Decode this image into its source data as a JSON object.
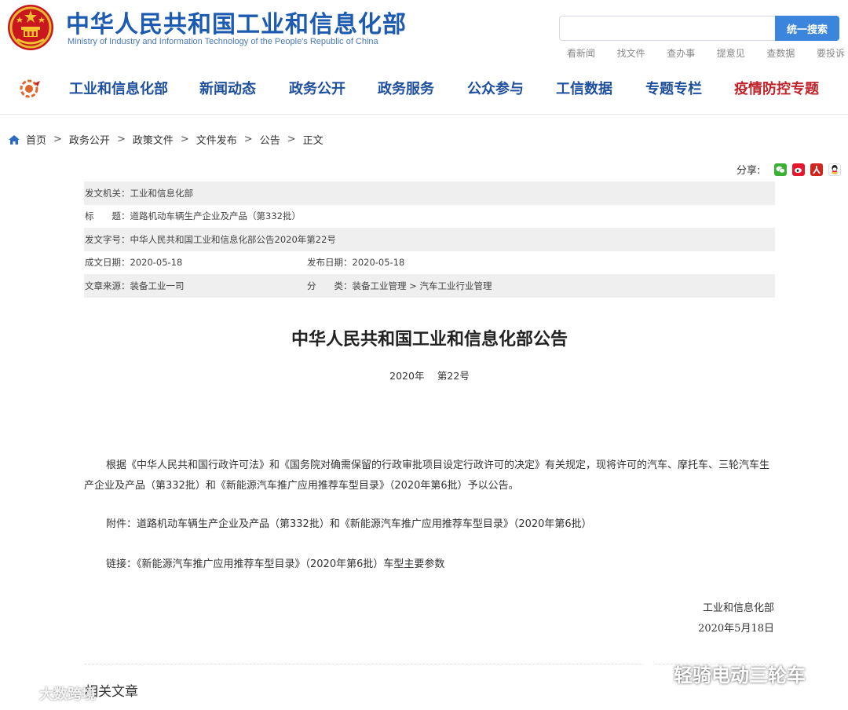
{
  "header": {
    "title_cn": "中华人民共和国工业和信息化部",
    "title_en": "Ministry of Industry and Information Technology of the People's Republic of China",
    "search_button": "统一搜索",
    "quick_links": [
      "看新闻",
      "找文件",
      "查办事",
      "提意见",
      "查数据",
      "要投诉"
    ]
  },
  "nav": {
    "items": [
      {
        "label": "工业和信息化部",
        "color": "#1d4f9c"
      },
      {
        "label": "新闻动态",
        "color": "#1d4f9c"
      },
      {
        "label": "政务公开",
        "color": "#1d4f9c"
      },
      {
        "label": "政务服务",
        "color": "#1d4f9c"
      },
      {
        "label": "公众参与",
        "color": "#1d4f9c"
      },
      {
        "label": "工信数据",
        "color": "#1d4f9c"
      },
      {
        "label": "专题专栏",
        "color": "#1d4f9c"
      },
      {
        "label": "疫情防控专题",
        "color": "#c0242b"
      }
    ]
  },
  "breadcrumb": {
    "items": [
      "首页",
      "政务公开",
      "政策文件",
      "文件发布",
      "公告",
      "正文"
    ],
    "separator": ">"
  },
  "share": {
    "label": "分享:",
    "icons": [
      "wechat-icon",
      "weibo-icon",
      "people-daily-icon",
      "qq-icon"
    ]
  },
  "meta": {
    "issuer_label": "发文机关：",
    "issuer_value": "工业和信息化部",
    "title_label": "标　　题：",
    "title_value": "道路机动车辆生产企业及产品（第332批）",
    "doc_no_label": "发文字号：",
    "doc_no_value": "中华人民共和国工业和信息化部公告2020年第22号",
    "created_label": "成文日期：",
    "created_value": "2020-05-18",
    "published_label": "发布日期：",
    "published_value": "2020-05-18",
    "source_label": "文章来源：",
    "source_value": "装备工业一司",
    "category_label": "分　　类：",
    "category_value": "装备工业管理 > 汽车工业行业管理"
  },
  "article": {
    "title": "中华人民共和国工业和信息化部公告",
    "number": "2020年　 第22号",
    "paragraph1": "根据《中华人民共和国行政许可法》和《国务院对确需保留的行政审批项目设定行政许可的决定》有关规定，现将许可的汽车、摩托车、三轮汽车生产企业及产品（第332批）和《新能源汽车推广应用推荐车型目录》（2020年第6批）予以公告。",
    "attachment": "附件：道路机动车辆生产企业及产品（第332批）和《新能源汽车推广应用推荐车型目录》（2020年第6批）",
    "link": "链接：《新能源汽车推广应用推荐车型目录》（2020年第6批）车型主要参数",
    "signature_org": "工业和信息化部",
    "signature_date": "2020年5月18日",
    "related_heading": "相关文章"
  },
  "watermarks": {
    "left": "大数跨境",
    "right": "轻骑电动三轮车"
  },
  "colors": {
    "brand_blue": "#1d5bb0",
    "nav_blue": "#1d4f9c",
    "accent_red": "#c0242b",
    "search_button": "#3b85dd",
    "meta_shade": "#efefef"
  }
}
